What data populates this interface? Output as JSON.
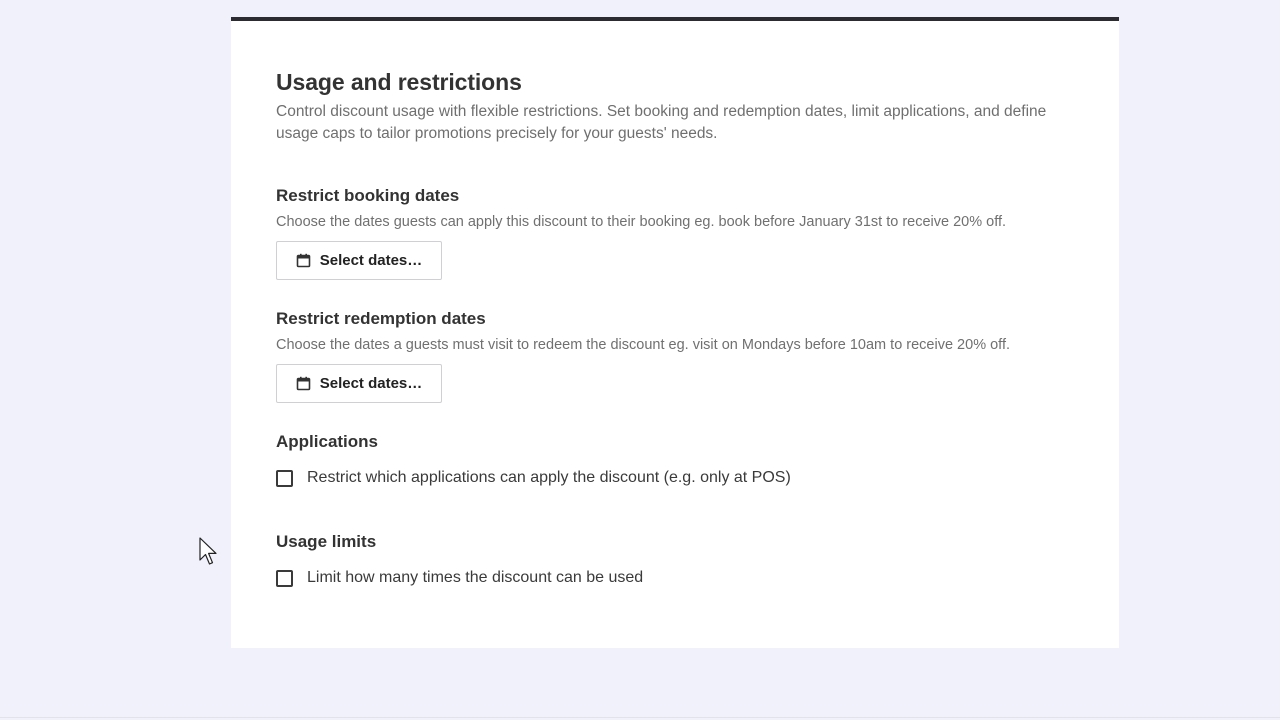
{
  "section": {
    "title": "Usage and restrictions",
    "description": "Control discount usage with flexible restrictions. Set booking and redemption dates, limit applications, and define usage caps to tailor promotions precisely for your guests' needs."
  },
  "booking_dates": {
    "title": "Restrict booking dates",
    "description": "Choose the dates guests can apply this discount to their booking eg. book before January 31st to receive 20% off.",
    "button_label": "Select dates…",
    "icon": "calendar-icon"
  },
  "redemption_dates": {
    "title": "Restrict redemption dates",
    "description": "Choose the dates a guests must visit to redeem the discount eg. visit on Mondays before 10am to receive 20% off.",
    "button_label": "Select dates…",
    "icon": "calendar-icon"
  },
  "applications": {
    "title": "Applications",
    "checkbox_label": "Restrict which applications can apply the discount (e.g. only at POS)",
    "checked": false
  },
  "usage_limits": {
    "title": "Usage limits",
    "checkbox_label": "Limit how many times the discount can be used",
    "checked": false
  },
  "colors": {
    "page_background": "#f1f1fb",
    "card_background": "#ffffff",
    "card_top_border": "#2b2b31",
    "heading_text": "#333333",
    "muted_text": "#6f6f6f"
  }
}
